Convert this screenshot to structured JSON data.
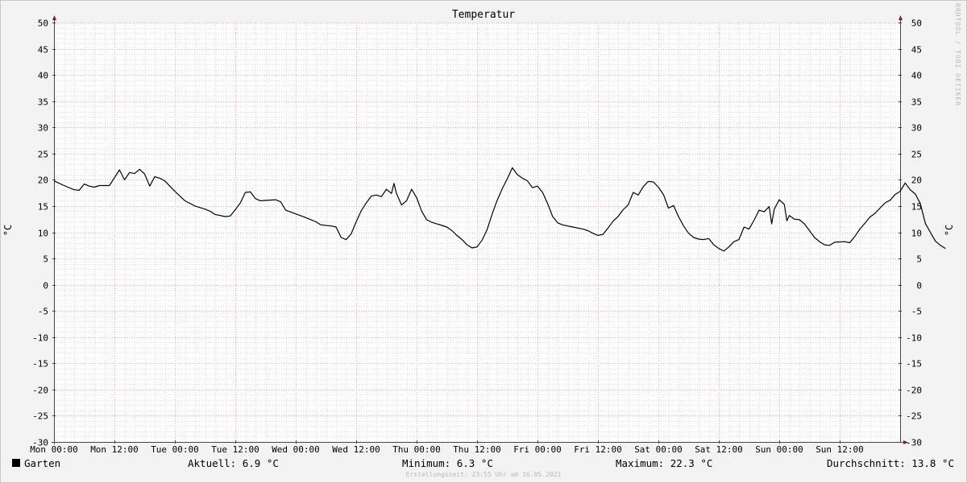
{
  "chart_data": {
    "type": "line",
    "title": "Temperatur",
    "ylabel_left": "°C",
    "ylabel_right": "°C",
    "ylim": [
      -30,
      50
    ],
    "y_ticks": [
      50,
      45,
      40,
      35,
      30,
      25,
      20,
      15,
      10,
      5,
      0,
      -5,
      -10,
      -15,
      -20,
      -25,
      -30
    ],
    "x_ticks": [
      "Mon 00:00",
      "Mon 12:00",
      "Tue 00:00",
      "Tue 12:00",
      "Wed 00:00",
      "Wed 12:00",
      "Thu 00:00",
      "Thu 12:00",
      "Fri 00:00",
      "Fri 12:00",
      "Sat 00:00",
      "Sat 12:00",
      "Sun 00:00",
      "Sun 12:00"
    ],
    "x_range_hours": [
      0,
      168
    ],
    "grid": true,
    "series": [
      {
        "name": "Garten",
        "color": "#000000",
        "points": [
          [
            0,
            19.8
          ],
          [
            2,
            18.9
          ],
          [
            4,
            18.1
          ],
          [
            5,
            18.0
          ],
          [
            6,
            19.2
          ],
          [
            7,
            18.8
          ],
          [
            8,
            18.6
          ],
          [
            9,
            18.9
          ],
          [
            11,
            18.9
          ],
          [
            13,
            21.9
          ],
          [
            14,
            20.0
          ],
          [
            15,
            21.4
          ],
          [
            16,
            21.2
          ],
          [
            17,
            22.0
          ],
          [
            18,
            21.1
          ],
          [
            19,
            18.8
          ],
          [
            20,
            20.6
          ],
          [
            21,
            20.3
          ],
          [
            22,
            19.8
          ],
          [
            24,
            17.8
          ],
          [
            26,
            16.0
          ],
          [
            28,
            15.0
          ],
          [
            30,
            14.4
          ],
          [
            31,
            14.0
          ],
          [
            32,
            13.4
          ],
          [
            34,
            13.0
          ],
          [
            35,
            13.1
          ],
          [
            36,
            14.3
          ],
          [
            37,
            15.6
          ],
          [
            38,
            17.6
          ],
          [
            39,
            17.7
          ],
          [
            40,
            16.4
          ],
          [
            41,
            16.0
          ],
          [
            44,
            16.2
          ],
          [
            45,
            15.8
          ],
          [
            46,
            14.2
          ],
          [
            48,
            13.5
          ],
          [
            50,
            12.8
          ],
          [
            52,
            12.0
          ],
          [
            53,
            11.4
          ],
          [
            55,
            11.2
          ],
          [
            56,
            11.0
          ],
          [
            57,
            9.0
          ],
          [
            58,
            8.6
          ],
          [
            59,
            9.7
          ],
          [
            60,
            12.0
          ],
          [
            61,
            14.1
          ],
          [
            62,
            15.6
          ],
          [
            63,
            16.9
          ],
          [
            64,
            17.1
          ],
          [
            65,
            16.8
          ],
          [
            66,
            18.2
          ],
          [
            67,
            17.4
          ],
          [
            67.5,
            19.3
          ],
          [
            68,
            17.4
          ],
          [
            69,
            15.2
          ],
          [
            70,
            16.0
          ],
          [
            71,
            18.2
          ],
          [
            72,
            16.6
          ],
          [
            73,
            14.0
          ],
          [
            74,
            12.4
          ],
          [
            75,
            11.9
          ],
          [
            76,
            11.6
          ],
          [
            77,
            11.3
          ],
          [
            78,
            11.0
          ],
          [
            79,
            10.3
          ],
          [
            80,
            9.4
          ],
          [
            81,
            8.6
          ],
          [
            82,
            7.6
          ],
          [
            83,
            7.0
          ],
          [
            84,
            7.2
          ],
          [
            85,
            8.5
          ],
          [
            86,
            10.5
          ],
          [
            87,
            13.5
          ],
          [
            88,
            16.1
          ],
          [
            89,
            18.3
          ],
          [
            90,
            20.2
          ],
          [
            91,
            22.3
          ],
          [
            92,
            21.0
          ],
          [
            93,
            20.3
          ],
          [
            94,
            19.8
          ],
          [
            95,
            18.5
          ],
          [
            96,
            18.8
          ],
          [
            97,
            17.6
          ],
          [
            98,
            15.5
          ],
          [
            99,
            13.0
          ],
          [
            100,
            11.8
          ],
          [
            101,
            11.4
          ],
          [
            103,
            11.0
          ],
          [
            105,
            10.6
          ],
          [
            106,
            10.3
          ],
          [
            107,
            9.8
          ],
          [
            108,
            9.4
          ],
          [
            109,
            9.6
          ],
          [
            110,
            10.8
          ],
          [
            111,
            12.1
          ],
          [
            112,
            13.0
          ],
          [
            113,
            14.3
          ],
          [
            114,
            15.2
          ],
          [
            115,
            17.6
          ],
          [
            116,
            17.1
          ],
          [
            117,
            18.7
          ],
          [
            118,
            19.7
          ],
          [
            119,
            19.6
          ],
          [
            120,
            18.6
          ],
          [
            121,
            17.2
          ],
          [
            122,
            14.6
          ],
          [
            123,
            15.1
          ],
          [
            124,
            13.0
          ],
          [
            125,
            11.2
          ],
          [
            126,
            9.8
          ],
          [
            127,
            9.0
          ],
          [
            128,
            8.7
          ],
          [
            129,
            8.6
          ],
          [
            130,
            8.8
          ],
          [
            131,
            7.6
          ],
          [
            132,
            6.9
          ],
          [
            133,
            6.4
          ],
          [
            134,
            7.2
          ],
          [
            135,
            8.2
          ],
          [
            136,
            8.6
          ],
          [
            137,
            11.0
          ],
          [
            138,
            10.6
          ],
          [
            139,
            12.3
          ],
          [
            140,
            14.2
          ],
          [
            141,
            13.9
          ],
          [
            142,
            14.9
          ],
          [
            142.5,
            11.6
          ],
          [
            143,
            14.4
          ],
          [
            144,
            16.2
          ],
          [
            145,
            15.3
          ],
          [
            145.5,
            12.2
          ],
          [
            146,
            13.2
          ],
          [
            147,
            12.5
          ],
          [
            148,
            12.4
          ],
          [
            149,
            11.6
          ],
          [
            150,
            10.3
          ],
          [
            151,
            9.0
          ],
          [
            152,
            8.2
          ],
          [
            153,
            7.6
          ],
          [
            154,
            7.5
          ],
          [
            155,
            8.1
          ],
          [
            157,
            8.2
          ],
          [
            158,
            8.0
          ],
          [
            159,
            9.2
          ],
          [
            160,
            10.6
          ],
          [
            161,
            11.7
          ],
          [
            162,
            12.9
          ],
          [
            163,
            13.6
          ],
          [
            164,
            14.6
          ],
          [
            165,
            15.6
          ],
          [
            166,
            16.1
          ],
          [
            167,
            17.2
          ],
          [
            168,
            17.8
          ],
          [
            169,
            19.4
          ],
          [
            170,
            18.1
          ],
          [
            171,
            17.3
          ],
          [
            172,
            15.5
          ],
          [
            173,
            11.7
          ],
          [
            174,
            10.0
          ],
          [
            175,
            8.3
          ],
          [
            176,
            7.5
          ],
          [
            177,
            6.9
          ]
        ]
      }
    ]
  },
  "legend": {
    "series_name": "Garten",
    "current": "Aktuell: 6.9 °C",
    "minimum": "Minimum: 6.3 °C",
    "maximum": "Maximum: 22.3 °C",
    "average": "Durchschnitt: 13.8 °C"
  },
  "watermark": "RRDTOOL / TOBI OETIKER",
  "footer": "Erstellungszeit: 23:55 Uhr am 16.05.2021"
}
